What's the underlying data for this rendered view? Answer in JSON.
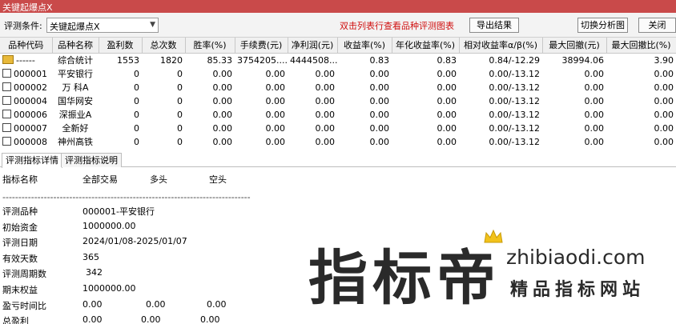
{
  "window": {
    "title": "关键起爆点X"
  },
  "toolbar": {
    "condition_label": "评测条件:",
    "condition_value": "关键起爆点X",
    "hint": "双击列表行查看品种评测图表",
    "export_label": "导出结果",
    "switch_label": "切换分析图",
    "close_label": "关闭"
  },
  "table": {
    "columns": [
      "品种代码",
      "品种名称",
      "盈利数",
      "总次数",
      "胜率(%)",
      "手续费(元)",
      "净利润(元)",
      "收益率(%)",
      "年化收益率(%)",
      "相对收益率α/β(%)",
      "最大回撤(元)",
      "最大回撤比(%)"
    ],
    "rows": [
      {
        "code": "------",
        "name": "综合统计",
        "win": "1553",
        "total": "1820",
        "rate": "85.33",
        "fee": "3754205....",
        "net": "4444508....",
        "ret": "0.83",
        "annual": "0.83",
        "rel": "0.84/-12.29",
        "mdd": "38994.06",
        "mddr": "3.90",
        "summary": true
      },
      {
        "code": "000001",
        "name": "平安银行",
        "win": "0",
        "total": "0",
        "rate": "0.00",
        "fee": "0.00",
        "net": "0.00",
        "ret": "0.00",
        "annual": "0.00",
        "rel": "0.00/-13.12",
        "mdd": "0.00",
        "mddr": "0.00"
      },
      {
        "code": "000002",
        "name": "万 科A",
        "win": "0",
        "total": "0",
        "rate": "0.00",
        "fee": "0.00",
        "net": "0.00",
        "ret": "0.00",
        "annual": "0.00",
        "rel": "0.00/-13.12",
        "mdd": "0.00",
        "mddr": "0.00"
      },
      {
        "code": "000004",
        "name": "国华网安",
        "win": "0",
        "total": "0",
        "rate": "0.00",
        "fee": "0.00",
        "net": "0.00",
        "ret": "0.00",
        "annual": "0.00",
        "rel": "0.00/-13.12",
        "mdd": "0.00",
        "mddr": "0.00"
      },
      {
        "code": "000006",
        "name": "深振业A",
        "win": "0",
        "total": "0",
        "rate": "0.00",
        "fee": "0.00",
        "net": "0.00",
        "ret": "0.00",
        "annual": "0.00",
        "rel": "0.00/-13.12",
        "mdd": "0.00",
        "mddr": "0.00"
      },
      {
        "code": "000007",
        "name": "全新好",
        "win": "0",
        "total": "0",
        "rate": "0.00",
        "fee": "0.00",
        "net": "0.00",
        "ret": "0.00",
        "annual": "0.00",
        "rel": "0.00/-13.12",
        "mdd": "0.00",
        "mddr": "0.00"
      },
      {
        "code": "000008",
        "name": "神州高铁",
        "win": "0",
        "total": "0",
        "rate": "0.00",
        "fee": "0.00",
        "net": "0.00",
        "ret": "0.00",
        "annual": "0.00",
        "rel": "0.00/-13.12",
        "mdd": "0.00",
        "mddr": "0.00"
      }
    ]
  },
  "tabs": [
    "评测指标详情",
    "评测指标说明"
  ],
  "detail": {
    "header": [
      "指标名称",
      "全部交易",
      "多头",
      "空头"
    ],
    "dashes": "------------------------------------------------------------------------------",
    "items": [
      {
        "label": "评测品种",
        "value": "000001-平安银行"
      },
      {
        "label": "初始资金",
        "value": "1000000.00"
      },
      {
        "label": "评测日期",
        "value": "2024/01/08-2025/01/07"
      },
      {
        "label": "有效天数",
        "value": "365"
      },
      {
        "label": "评测周期数",
        "value": "342"
      },
      {
        "label": "期末权益",
        "value": "1000000.00"
      },
      {
        "label": "盈亏时间比",
        "value": "0.00",
        "v2": "0.00",
        "v3": "0.00"
      },
      {
        "label": "总盈利",
        "value": "0.00",
        "v2": "0.00",
        "v3": "0.00"
      }
    ]
  },
  "watermark": {
    "brand": "指标帝",
    "url": "zhibiaodi.com",
    "tagline": "精品指标网站"
  },
  "colors": {
    "titlebar": "#c94a4a",
    "hint": "#d01010"
  }
}
